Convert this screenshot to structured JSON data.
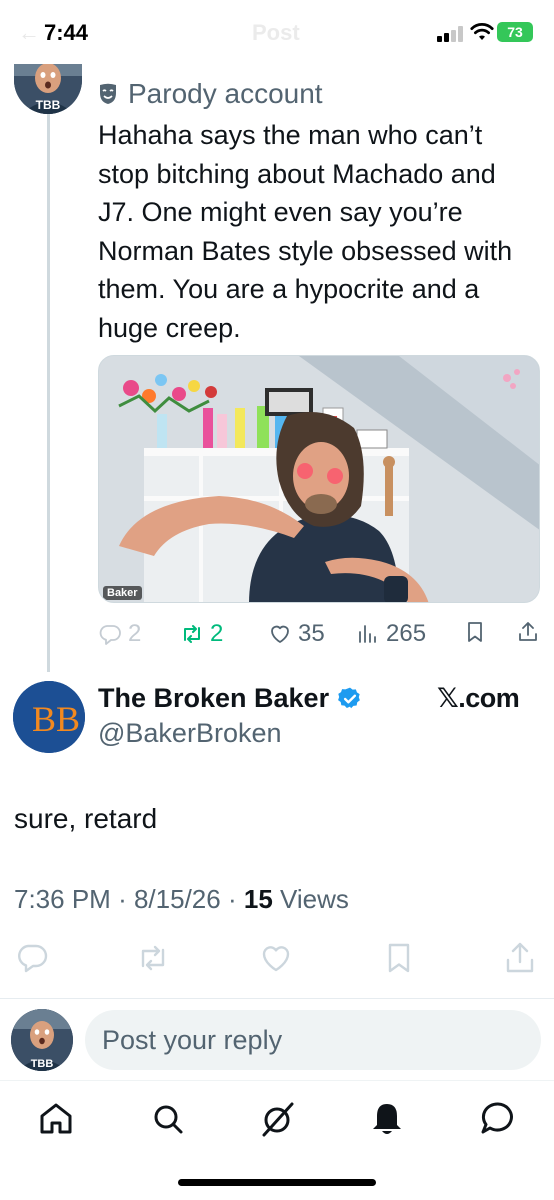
{
  "status_bar": {
    "time": "7:44",
    "battery": "73",
    "ghost_back": "←",
    "ghost_title": "Post"
  },
  "parent_tweet": {
    "avatar_text": "TBB",
    "label": "Parody account",
    "text": "Hahaha says the man who can’t stop bitching about Machado and J7. One might even say you’re Norman Bates style obsessed with them. You are a hypocrite and a huge creep.",
    "media_caption": "Baker",
    "actions": {
      "replies": "2",
      "reposts": "2",
      "likes": "35",
      "views": "265"
    }
  },
  "main_tweet": {
    "avatar_monogram": "BB",
    "display_name": "The Broken Baker",
    "handle": "@BakerBroken",
    "source_label": "𝕏.com",
    "text": "sure, retard",
    "time": "7:36 PM",
    "date": "8/15/26",
    "views_count": "15",
    "views_label": "Views",
    "separator": "·"
  },
  "reply_bar": {
    "avatar_text": "TBB",
    "placeholder": "Post your reply"
  },
  "colors": {
    "accent": "#1d9bf0",
    "repost_green": "#00ba7c",
    "secondary_text": "#536471",
    "brand_blue": "#1c4f94",
    "brand_orange": "#f2891f"
  },
  "icons": {
    "tabs": [
      "home-icon",
      "search-icon",
      "grok-icon",
      "notifications-icon",
      "messages-icon"
    ],
    "main_actions": [
      "reply-icon",
      "repost-icon",
      "like-icon",
      "bookmark-icon",
      "share-icon"
    ]
  }
}
